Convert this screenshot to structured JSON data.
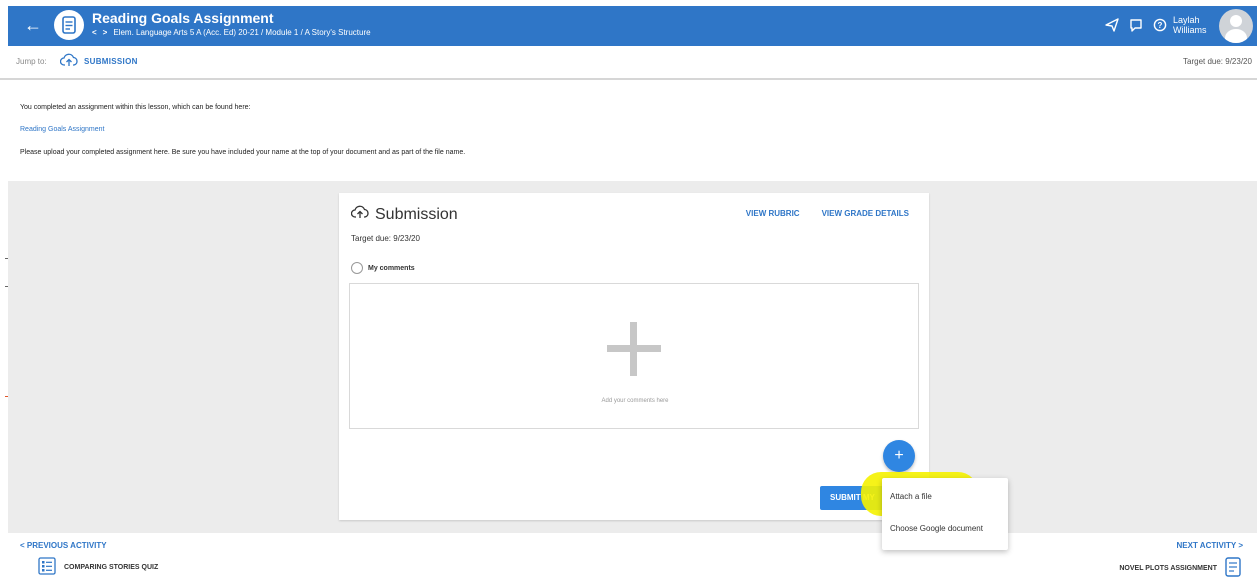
{
  "header": {
    "title": "Reading Goals Assignment",
    "breadcrumb": "Elem. Language Arts 5 A (Acc. Ed) 20-21 / Module 1 / A Story's Structure",
    "user_first": "Laylah",
    "user_last": "Williams",
    "icons": [
      "back-arrow-icon",
      "assignment-icon",
      "send-icon",
      "comment-icon",
      "help-icon",
      "user-avatar-icon"
    ]
  },
  "jump": {
    "label": "Jump to:",
    "link": "SUBMISSION",
    "target_due": "Target due: 9/23/20"
  },
  "body": {
    "intro": "You completed an assignment within this lesson, which can be found here:",
    "assignment_link": "Reading Goals Assignment",
    "instructions": "Please upload your completed assignment here. Be sure you have included your name at the top of your document and as part of the file name."
  },
  "submission": {
    "title": "Submission",
    "view_rubric": "VIEW RUBRIC",
    "view_grade_details": "VIEW GRADE DETAILS",
    "target_due": "Target due: 9/23/20",
    "comments_label": "My comments",
    "comments_placeholder": "Add your comments here",
    "fab_label": "+",
    "submit_label": "SUBMIT MY"
  },
  "attach_menu": {
    "items": [
      "Attach a file",
      "Choose Google document"
    ]
  },
  "footer": {
    "previous_label": "< PREVIOUS ACTIVITY",
    "previous_item": "COMPARING STORIES QUIZ",
    "next_label": "NEXT ACTIVITY >",
    "next_item": "NOVEL PLOTS ASSIGNMENT"
  },
  "colors": {
    "header_blue": "#2f76c7",
    "button_blue": "#2f86e2",
    "highlight_yellow": "#f5f200",
    "grey_background": "#ececec"
  }
}
